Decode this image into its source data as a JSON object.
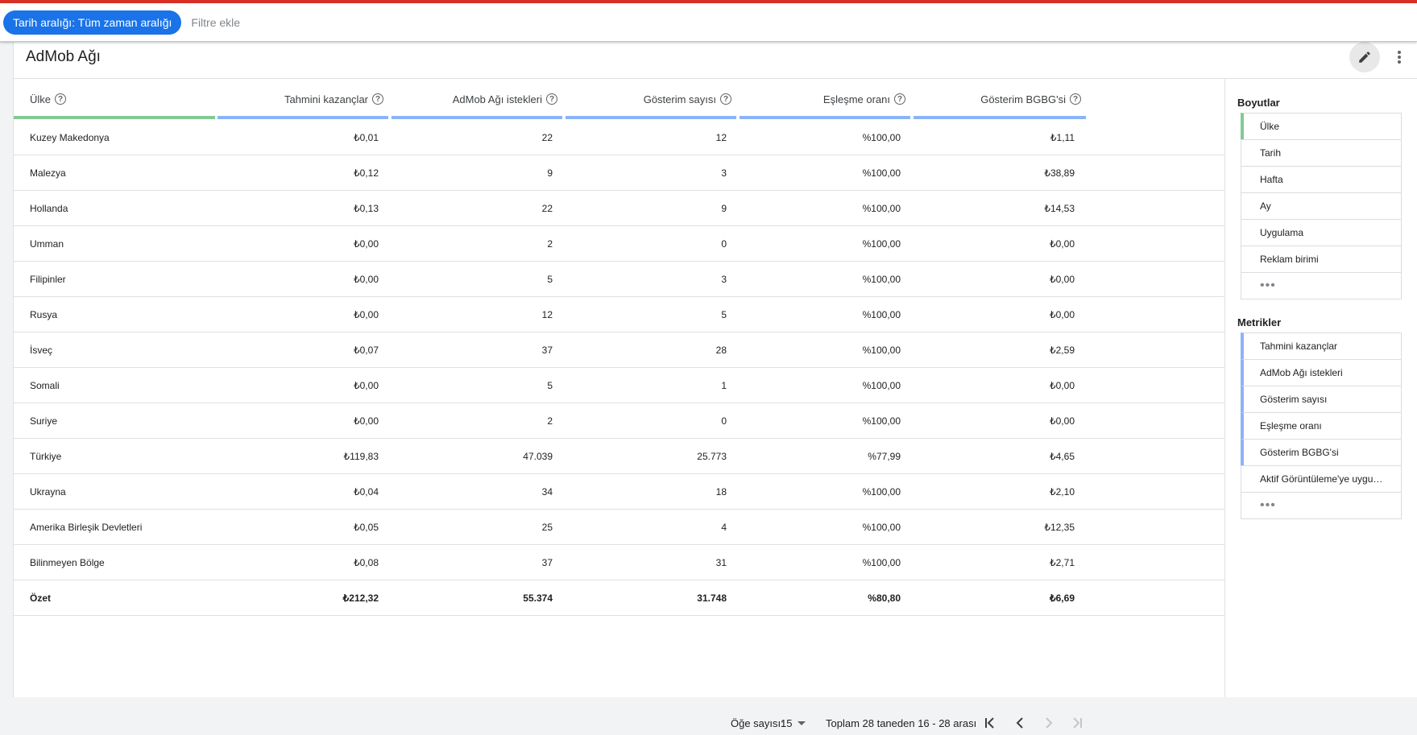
{
  "filters": {
    "date_chip": "Tarih aralığı: Tüm zaman aralığı",
    "add_filter": "Filtre ekle"
  },
  "card": {
    "title": "AdMob Ağı"
  },
  "table": {
    "columns": [
      {
        "label": "Ülke"
      },
      {
        "label": "Tahmini kazançlar"
      },
      {
        "label": "AdMob Ağı istekleri"
      },
      {
        "label": "Gösterim sayısı"
      },
      {
        "label": "Eşleşme oranı"
      },
      {
        "label": "Gösterim BGBG'si"
      }
    ],
    "rows": [
      [
        "Kuzey Makedonya",
        "₺0,01",
        "22",
        "12",
        "%100,00",
        "₺1,11"
      ],
      [
        "Malezya",
        "₺0,12",
        "9",
        "3",
        "%100,00",
        "₺38,89"
      ],
      [
        "Hollanda",
        "₺0,13",
        "22",
        "9",
        "%100,00",
        "₺14,53"
      ],
      [
        "Umman",
        "₺0,00",
        "2",
        "0",
        "%100,00",
        "₺0,00"
      ],
      [
        "Filipinler",
        "₺0,00",
        "5",
        "3",
        "%100,00",
        "₺0,00"
      ],
      [
        "Rusya",
        "₺0,00",
        "12",
        "5",
        "%100,00",
        "₺0,00"
      ],
      [
        "İsveç",
        "₺0,07",
        "37",
        "28",
        "%100,00",
        "₺2,59"
      ],
      [
        "Somali",
        "₺0,00",
        "5",
        "1",
        "%100,00",
        "₺0,00"
      ],
      [
        "Suriye",
        "₺0,00",
        "2",
        "0",
        "%100,00",
        "₺0,00"
      ],
      [
        "Türkiye",
        "₺119,83",
        "47.039",
        "25.773",
        "%77,99",
        "₺4,65"
      ],
      [
        "Ukrayna",
        "₺0,04",
        "34",
        "18",
        "%100,00",
        "₺2,10"
      ],
      [
        "Amerika Birleşik Devletleri",
        "₺0,05",
        "25",
        "4",
        "%100,00",
        "₺12,35"
      ],
      [
        "Bilinmeyen Bölge",
        "₺0,08",
        "37",
        "31",
        "%100,00",
        "₺2,71"
      ]
    ],
    "summary": [
      "Özet",
      "₺212,32",
      "55.374",
      "31.748",
      "%80,80",
      "₺6,69"
    ]
  },
  "pagination": {
    "page_size_label": "Öğe sayısı:",
    "page_size_value": "15",
    "range_text": "Toplam 28 taneden 16 - 28 arası"
  },
  "sidebar": {
    "dimensions_title": "Boyutlar",
    "dimensions": [
      "Ülke",
      "Tarih",
      "Hafta",
      "Ay",
      "Uygulama",
      "Reklam birimi"
    ],
    "metrics_title": "Metrikler",
    "metrics": [
      "Tahmini kazançlar",
      "AdMob Ağı istekleri",
      "Gösterim sayısı",
      "Eşleşme oranı",
      "Gösterim BGBG'si",
      "Aktif Görüntüleme'ye uygu…"
    ],
    "more_glyph": "•••"
  },
  "colors": {
    "accent_blue": "#1a73e8",
    "dimension_bar": "#81c995",
    "metric_bar": "#8ab4f8",
    "top_line": "#d93025"
  },
  "icons": [
    "edit-icon",
    "more-vert-icon",
    "help-icon",
    "dropdown-arrow-icon",
    "first-page-icon",
    "prev-page-icon",
    "next-page-icon",
    "last-page-icon"
  ]
}
